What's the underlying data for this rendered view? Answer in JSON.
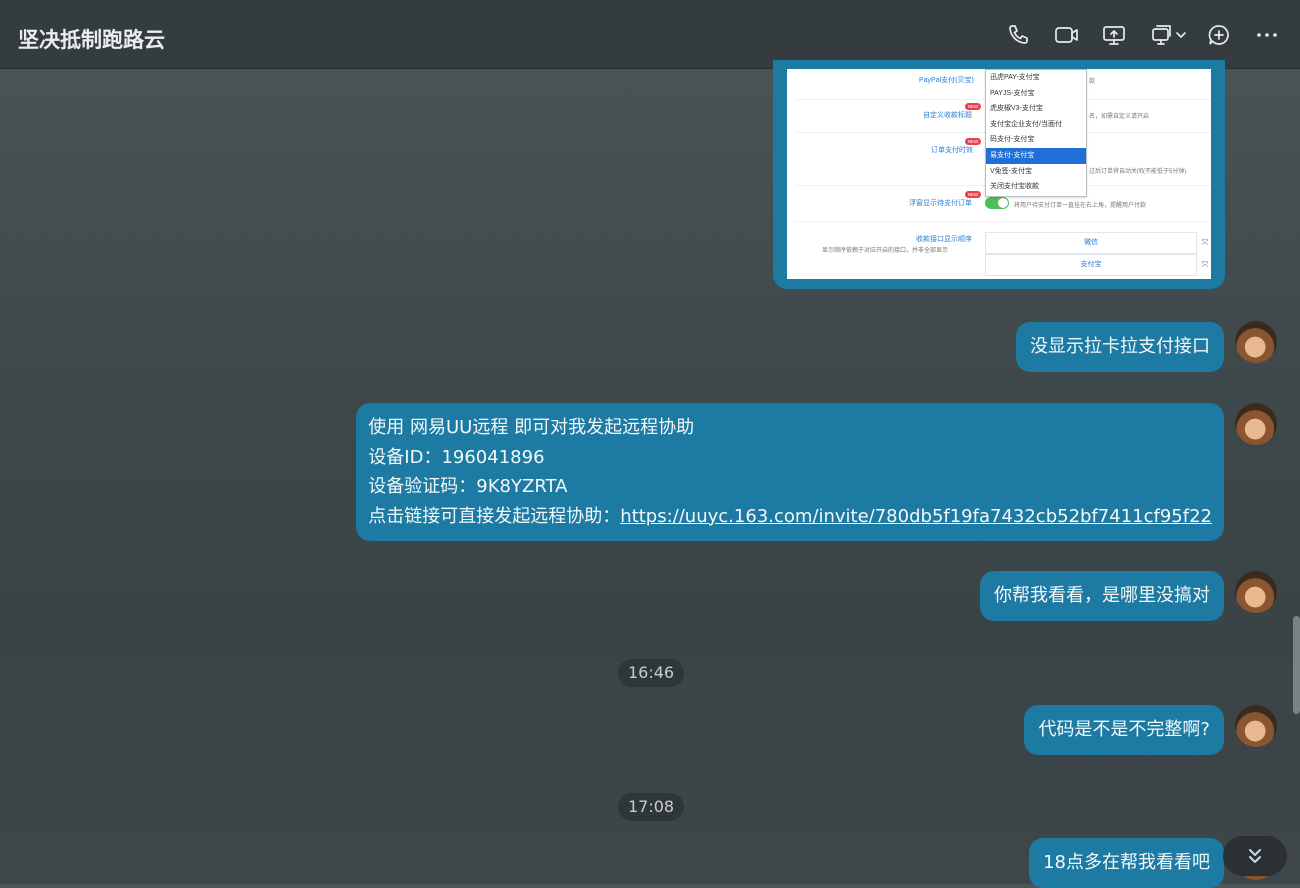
{
  "header": {
    "title": "坚决抵制跑路云",
    "icons": [
      "phone-icon",
      "video-icon",
      "screen-share-icon",
      "remote-desktop-icon",
      "chevron-down-icon",
      "add-circle-icon",
      "more-icon"
    ]
  },
  "screenshot": {
    "labels": {
      "paypal": "PayPal支付(贝宝)",
      "custom_title": "自定义收款标题",
      "timeout": "订单支付时效",
      "float": "浮窗显示待支付订单",
      "order": "收款接口显示顺序",
      "order_desc": "显示顺序依赖于对应开启的接口，并非全部显示",
      "new": "NEW"
    },
    "descs": {
      "paypal": "款",
      "custom_title": "名，如需自定义请开启",
      "timeout": "过后订单将自动关闭(不能低于5分钟)",
      "float": "将用户待支付订单一直挂在右上角，提醒用户付款"
    },
    "dropdown_options": [
      "迅虎PAY-支付宝",
      "PAYJS-支付宝",
      "虎皮椒V3-支付宝",
      "支付宝企业支付/当面付",
      "码支付-支付宝",
      "易支付-支付宝",
      "V免签-支付宝",
      "关闭支付宝收款"
    ],
    "dropdown_selected": "易支付-支付宝",
    "order_items": [
      "微信",
      "支付宝"
    ]
  },
  "messages": {
    "m1": "没显示拉卡拉支付接口",
    "m2": {
      "line1": "使用 网易UU远程 即可对我发起远程协助",
      "line2": "设备ID：196041896",
      "line3": "设备验证码：9K8YZRTA",
      "line4_prefix": "点击链接可直接发起远程协助：",
      "link": "https://uuyc.163.com/invite/780db5f19fa7432cb52bf7411cf95f22"
    },
    "m3": "你帮我看看，是哪里没搞对",
    "t1": "16:46",
    "m4": "代码是不是不完整啊?",
    "t2": "17:08",
    "m5": "18点多在帮我看看吧"
  },
  "colors": {
    "bubble": "#1d7aa3",
    "header": "#353c3f",
    "background": "#434c4e"
  }
}
